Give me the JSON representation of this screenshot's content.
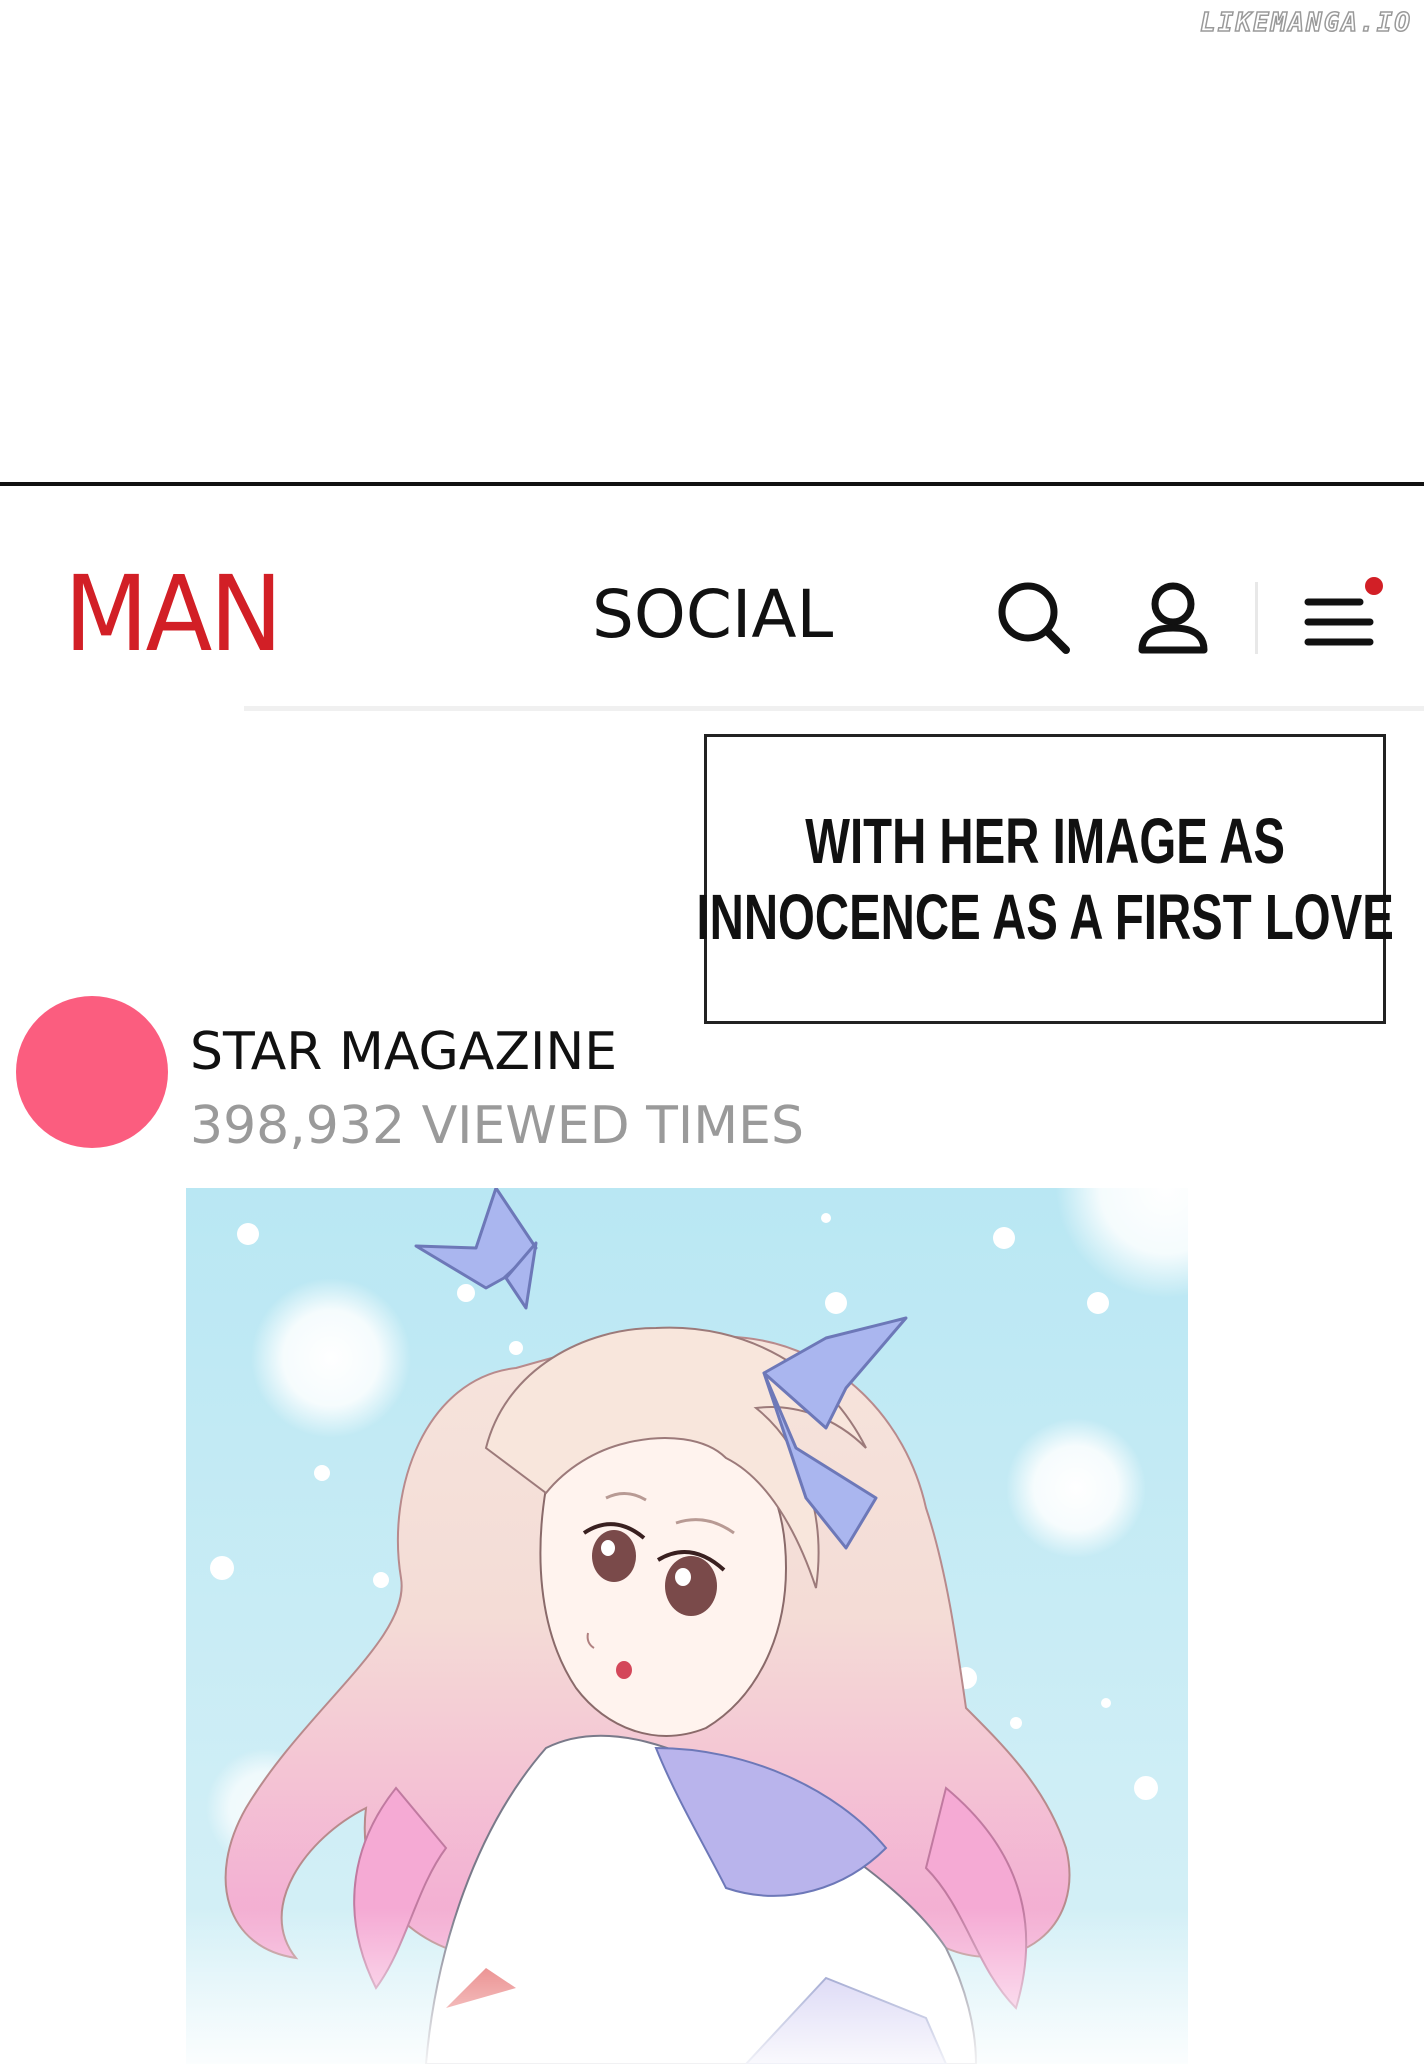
{
  "watermark": "LIKEMANGA.IO",
  "header": {
    "logo": "MAN",
    "section": "SOCIAL",
    "icons": {
      "search": "search-icon",
      "user": "user-icon",
      "menu": "menu-icon"
    },
    "notification_color": "#d21f26"
  },
  "caption": {
    "line1": "WITH HER IMAGE AS",
    "line2": "INNOCENCE AS A FIRST LOVE"
  },
  "post": {
    "author": "STAR MAGAZINE",
    "views": "398,932 VIEWED TIMES",
    "avatar_color": "#fb5d7f"
  },
  "colors": {
    "brand": "#d21f26",
    "sky": "#c9eef7",
    "hair_pink": "#f7b8d8",
    "ribbon": "#a6b4ec"
  }
}
